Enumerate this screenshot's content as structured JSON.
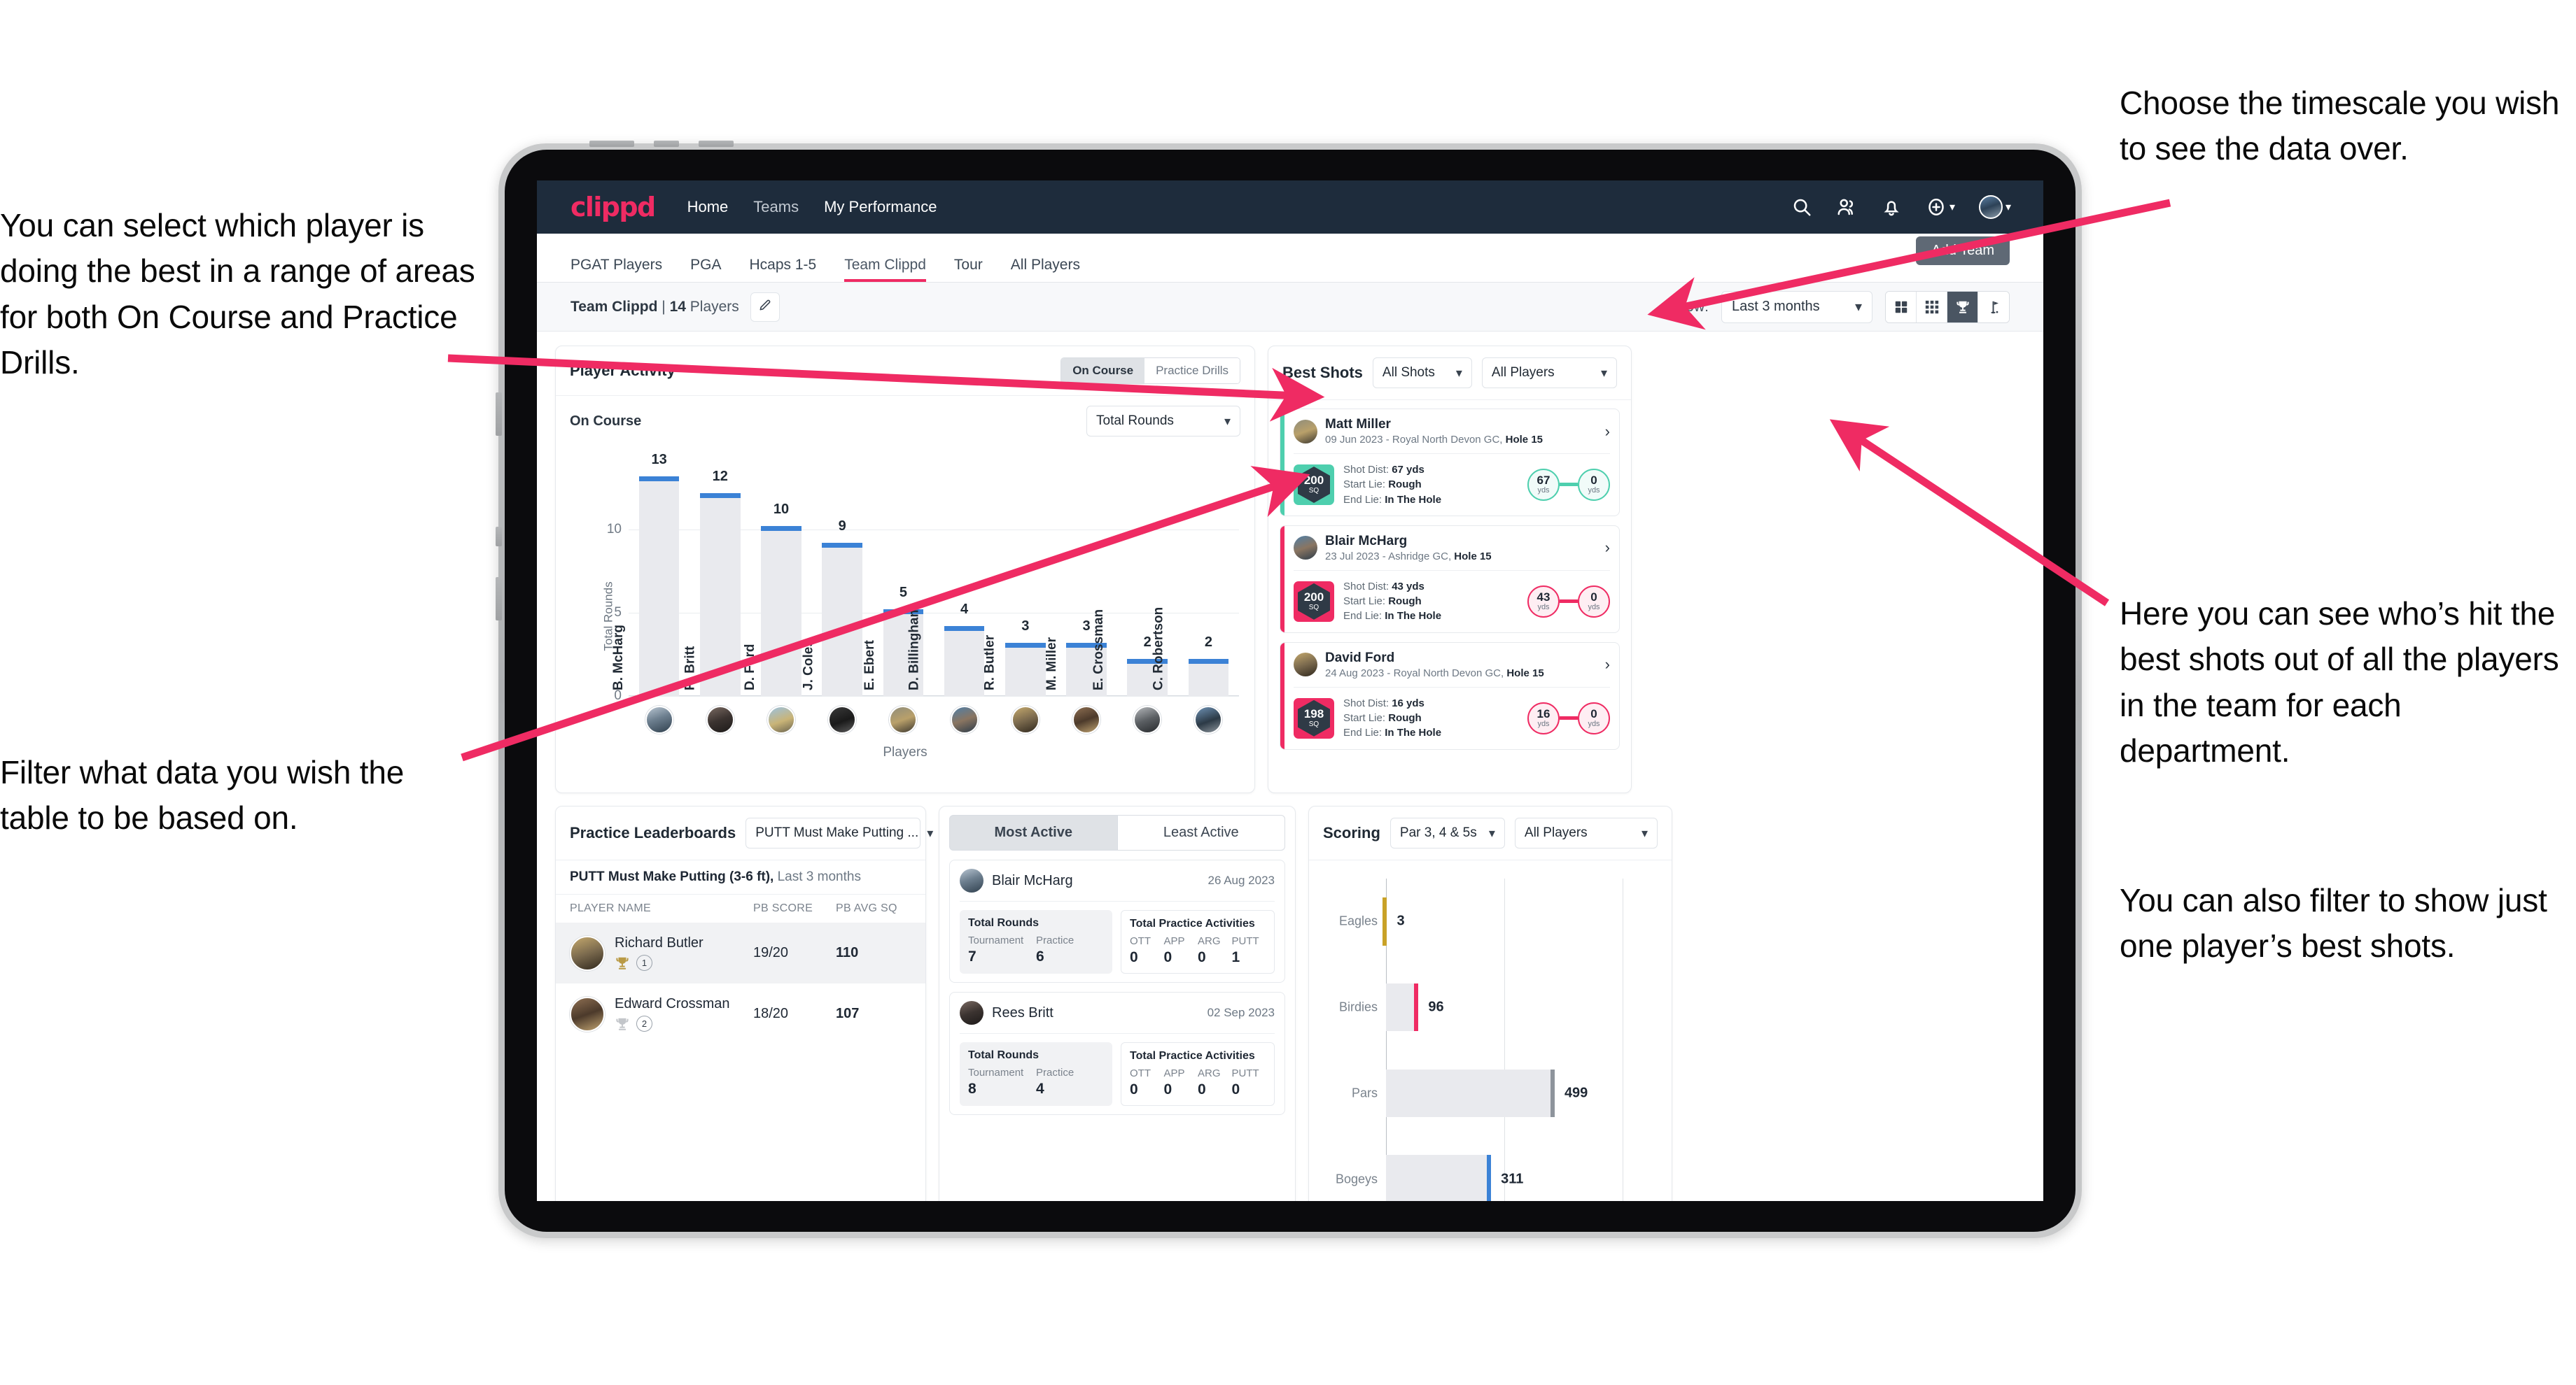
{
  "annotations": {
    "left_top": "You can select which player is doing the best in a range of areas for both On Course and Practice Drills.",
    "left_bottom": "Filter what data you wish the table to be based on.",
    "right_top": "Choose the timescale you wish to see the data over.",
    "right_middle": "Here you can see who’s hit the best shots out of all the players in the team for each department.",
    "right_bottom": "You can also filter to show just one player’s best shots."
  },
  "navbar": {
    "logo": "clippd",
    "links": [
      "Home",
      "Teams",
      "My Performance"
    ],
    "icons": [
      "search-icon",
      "people-icon",
      "bell-icon",
      "plus-circle-icon",
      "avatar-icon"
    ]
  },
  "tabs": {
    "items": [
      "PGAT Players",
      "PGA",
      "Hcaps 1-5",
      "Team Clippd",
      "Tour",
      "All Players"
    ],
    "active": "Team Clippd",
    "tooltip": "Add Team"
  },
  "subbar": {
    "team_name": "Team Clippd",
    "team_sep": " | ",
    "team_count": "14",
    "team_players_word": " Players",
    "edit_icon": "pencil-icon",
    "show_label": "Show:",
    "period_value": "Last 3 months",
    "view_modes": [
      "grid-large-icon",
      "grid-small-icon",
      "trophy-icon",
      "flag-icon"
    ],
    "view_active_index": 2
  },
  "player_activity": {
    "title": "Player Activity",
    "segments": [
      "On Course",
      "Practice Drills"
    ],
    "segment_active": "On Course",
    "sub_label": "On Course",
    "metric_select": "Total Rounds"
  },
  "chart_data": [
    {
      "type": "bar",
      "title": "Player Activity — On Course",
      "xlabel": "Players",
      "ylabel": "Total Rounds",
      "ylim": [
        0,
        14
      ],
      "yticks": [
        0,
        5,
        10
      ],
      "grid": true,
      "categories": [
        "B. McHarg",
        "R. Britt",
        "D. Ford",
        "J. Coles",
        "E. Ebert",
        "D. Billingham",
        "R. Butler",
        "M. Miller",
        "E. Crossman",
        "C. Robertson"
      ],
      "values": [
        13,
        12,
        10,
        9,
        5,
        4,
        3,
        3,
        2,
        2
      ],
      "bar_color": "#e9eaee",
      "cap_color": "#3b82d6"
    },
    {
      "type": "bar",
      "orientation": "horizontal",
      "title": "Scoring",
      "xlim": [
        0,
        700
      ],
      "grid": true,
      "categories": [
        "Eagles",
        "Birdies",
        "Pars",
        "Bogeys"
      ],
      "values": [
        3,
        96,
        499,
        311
      ],
      "cap_colors": [
        "#c9a227",
        "#ef2b63",
        "#8e949c",
        "#3b82d6"
      ],
      "bar_color": "#e9eaee"
    }
  ],
  "best_shots": {
    "title": "Best Shots",
    "filter_shots": "All Shots",
    "filter_players": "All Players",
    "items": [
      {
        "player": "Matt Miller",
        "meta_date": "09 Jun 2023",
        "meta_course": " - Royal North Devon GC, ",
        "meta_hole": "Hole 15",
        "accent": "#4ecfae",
        "badge_value": "200",
        "badge_unit": "SQ",
        "shot_dist_label": "Shot Dist: ",
        "shot_dist": "67 yds",
        "start_lie_label": "Start Lie: ",
        "start_lie": "Rough",
        "end_lie_label": "End Lie: ",
        "end_lie": "In The Hole",
        "start_val": "67",
        "start_unit": "yds",
        "end_val": "0",
        "end_unit": "yds"
      },
      {
        "player": "Blair McHarg",
        "meta_date": "23 Jul 2023",
        "meta_course": " - Ashridge GC, ",
        "meta_hole": "Hole 15",
        "accent": "#ef2b63",
        "badge_value": "200",
        "badge_unit": "SQ",
        "shot_dist_label": "Shot Dist: ",
        "shot_dist": "43 yds",
        "start_lie_label": "Start Lie: ",
        "start_lie": "Rough",
        "end_lie_label": "End Lie: ",
        "end_lie": "In The Hole",
        "start_val": "43",
        "start_unit": "yds",
        "end_val": "0",
        "end_unit": "yds"
      },
      {
        "player": "David Ford",
        "meta_date": "24 Aug 2023",
        "meta_course": " - Royal North Devon GC, ",
        "meta_hole": "Hole 15",
        "accent": "#ef2b63",
        "badge_value": "198",
        "badge_unit": "SQ",
        "shot_dist_label": "Shot Dist: ",
        "shot_dist": "16 yds",
        "start_lie_label": "Start Lie: ",
        "start_lie": "Rough",
        "end_lie_label": "End Lie: ",
        "end_lie": "In The Hole",
        "start_val": "16",
        "start_unit": "yds",
        "end_val": "0",
        "end_unit": "yds"
      }
    ]
  },
  "practice_leaderboards": {
    "title": "Practice Leaderboards",
    "drill_select": "PUTT Must Make Putting ...",
    "caption_bold": "PUTT Must Make Putting (3-6 ft),",
    "caption_rest": " Last 3 months",
    "columns": [
      "PLAYER NAME",
      "PB SCORE",
      "PB AVG SQ"
    ],
    "rows": [
      {
        "name": "Richard Butler",
        "rank": "1",
        "trophy": "gold",
        "pb_score": "19/20",
        "pb_avg_sq": "110"
      },
      {
        "name": "Edward Crossman",
        "rank": "2",
        "trophy": "silver",
        "pb_score": "18/20",
        "pb_avg_sq": "107"
      }
    ]
  },
  "activity_panel": {
    "tabs": [
      "Most Active",
      "Least Active"
    ],
    "tab_active": "Most Active",
    "rounds_title": "Total Rounds",
    "rounds_cols": [
      "Tournament",
      "Practice"
    ],
    "practice_title": "Total Practice Activities",
    "practice_cols": [
      "OTT",
      "APP",
      "ARG",
      "PUTT"
    ],
    "items": [
      {
        "name": "Blair McHarg",
        "date": "26 Aug 2023",
        "rounds": [
          "7",
          "6"
        ],
        "practice": [
          "0",
          "0",
          "0",
          "1"
        ]
      },
      {
        "name": "Rees Britt",
        "date": "02 Sep 2023",
        "rounds": [
          "8",
          "4"
        ],
        "practice": [
          "0",
          "0",
          "0",
          "0"
        ]
      }
    ]
  },
  "scoring": {
    "title": "Scoring",
    "filter_par": "Par 3, 4 & 5s",
    "filter_players": "All Players"
  },
  "colors": {
    "brand_pink": "#ef2b63",
    "nav_dark": "#1e2c3c",
    "bar_blue": "#3b82d6",
    "mint": "#4ecfae"
  }
}
